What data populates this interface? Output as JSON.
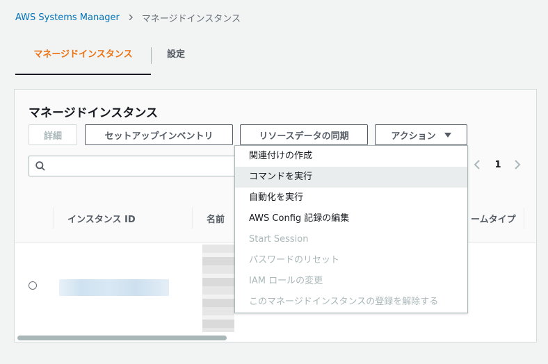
{
  "breadcrumb": {
    "root": "AWS Systems Manager",
    "current": "マネージドインスタンス"
  },
  "tabs": [
    {
      "label": "マネージドインスタンス",
      "active": true
    },
    {
      "label": "設定",
      "active": false
    }
  ],
  "panel": {
    "title": "マネージドインスタンス",
    "buttons": {
      "detail": "詳細",
      "setup_inventory": "セットアップインベントリ",
      "resource_data_sync": "リソースデータの同期",
      "actions": "アクション"
    },
    "search": {
      "placeholder": ""
    },
    "pagination": {
      "current_page": "1"
    }
  },
  "table": {
    "columns": [
      "インスタンス ID",
      "名前",
      "ームタイプ"
    ]
  },
  "actions_menu": {
    "items": [
      {
        "label": "関連付けの作成",
        "enabled": true
      },
      {
        "label": "コマンドを実行",
        "enabled": true,
        "hovered": true
      },
      {
        "label": "自動化を実行",
        "enabled": true
      },
      {
        "label": "AWS Config 記録の編集",
        "enabled": true
      },
      {
        "label": "Start Session",
        "enabled": false
      },
      {
        "label": "パスワードのリセット",
        "enabled": false
      },
      {
        "label": "IAM ロールの変更",
        "enabled": false
      },
      {
        "label": "このマネージドインスタンスの登録を解除する",
        "enabled": false
      }
    ]
  },
  "colors": {
    "accent": "#ec7211",
    "link": "#0073bb",
    "disabled": "#aab7b8"
  }
}
